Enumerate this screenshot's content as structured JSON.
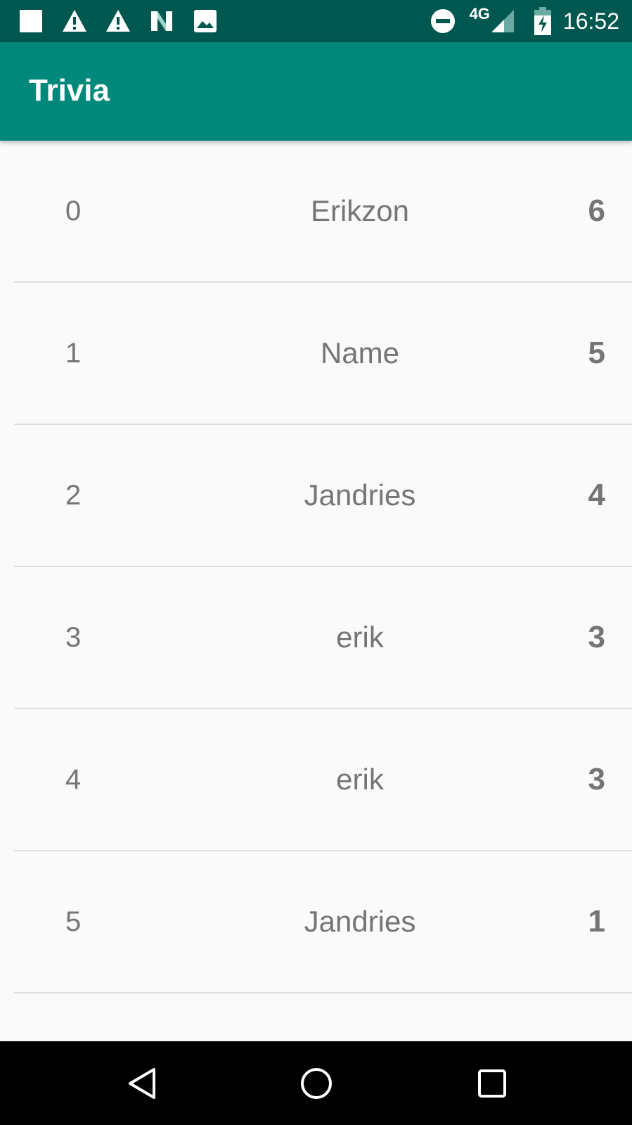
{
  "status_bar": {
    "time": "16:52",
    "network": "4G",
    "left_icons": [
      "square-notification-icon",
      "warning-icon",
      "warning-icon",
      "n-logo-icon",
      "image-icon"
    ],
    "right_icons": [
      "do-not-disturb-icon",
      "signal-icon",
      "battery-charging-icon"
    ]
  },
  "app_bar": {
    "title": "Trivia"
  },
  "scores": [
    {
      "index": "0",
      "name": "Erikzon",
      "score": "6"
    },
    {
      "index": "1",
      "name": "Name",
      "score": "5"
    },
    {
      "index": "2",
      "name": "Jandries",
      "score": "4"
    },
    {
      "index": "3",
      "name": "erik",
      "score": "3"
    },
    {
      "index": "4",
      "name": "erik",
      "score": "3"
    },
    {
      "index": "5",
      "name": "Jandries",
      "score": "1"
    }
  ],
  "nav_bar": {
    "buttons": [
      "back-icon",
      "home-icon",
      "recents-icon"
    ]
  },
  "colors": {
    "status_bar": "#00574f",
    "app_bar": "#00897b",
    "background": "#fafafa",
    "text": "#757575",
    "divider": "#dedede",
    "nav_bar": "#000000"
  }
}
